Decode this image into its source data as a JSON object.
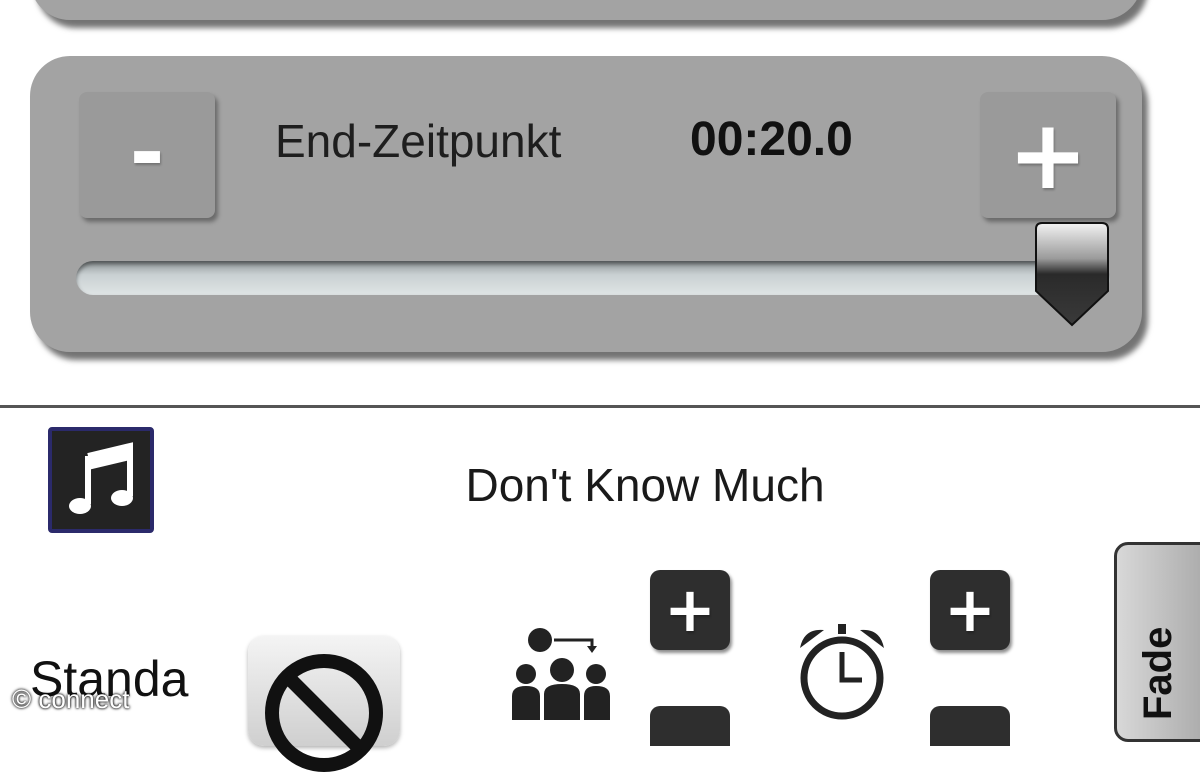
{
  "top_panel": {},
  "end_time": {
    "label": "End-Zeitpunkt",
    "value": "00:20.0",
    "minus_label": "-",
    "plus_label": "+",
    "slider_fraction": 1.0
  },
  "now_playing": {
    "icon": "music-note-icon",
    "title": "Don't Know Much"
  },
  "controls": {
    "mode_label": "Standa",
    "cancel_icon": "prohibited-icon",
    "people_icon": "people-swap-icon",
    "alarm_icon": "alarm-clock-icon",
    "fade_label": "Fade"
  },
  "watermark": "© connect",
  "colors": {
    "panel": "#a3a3a3",
    "button": "#9a9a9a",
    "dark_button": "#2e2e2e",
    "music_icon_border": "#2b2a6b"
  }
}
